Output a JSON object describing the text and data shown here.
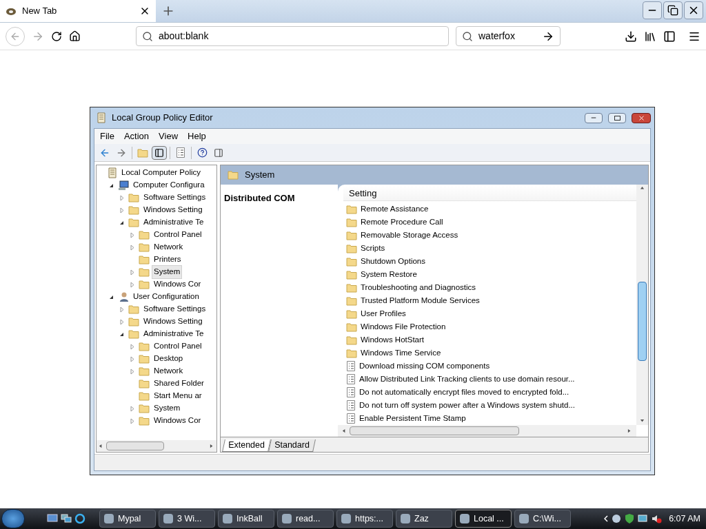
{
  "browser": {
    "tab": {
      "title": "New Tab",
      "selected": true
    },
    "address": "about:blank",
    "search": "waterfox"
  },
  "window": {
    "title": "Local Group Policy Editor",
    "menu": [
      "File",
      "Action",
      "View",
      "Help"
    ],
    "tree": [
      {
        "label": "Local Computer Policy",
        "kind": "policy",
        "selected": false,
        "children": [
          {
            "label": "Computer Configura",
            "kind": "computer",
            "expanded": true,
            "selected": false,
            "children": [
              {
                "label": "Software Settings",
                "kind": "folder",
                "expanded": false,
                "selected": false
              },
              {
                "label": "Windows Setting",
                "kind": "folder",
                "expanded": false,
                "selected": false
              },
              {
                "label": "Administrative Te",
                "kind": "folder",
                "expanded": true,
                "selected": false,
                "children": [
                  {
                    "label": "Control Panel",
                    "kind": "folder",
                    "expanded": false,
                    "selected": false
                  },
                  {
                    "label": "Network",
                    "kind": "folder",
                    "expanded": false,
                    "selected": false
                  },
                  {
                    "label": "Printers",
                    "kind": "folder",
                    "selected": false
                  },
                  {
                    "label": "System",
                    "kind": "folder",
                    "expanded": false,
                    "selected": true
                  },
                  {
                    "label": "Windows Cor",
                    "kind": "folder",
                    "expanded": false,
                    "selected": false
                  }
                ]
              }
            ]
          },
          {
            "label": "User Configuration",
            "kind": "user",
            "expanded": true,
            "selected": false,
            "children": [
              {
                "label": "Software Settings",
                "kind": "folder",
                "expanded": false,
                "selected": false
              },
              {
                "label": "Windows Setting",
                "kind": "folder",
                "expanded": false,
                "selected": false
              },
              {
                "label": "Administrative Te",
                "kind": "folder",
                "expanded": true,
                "selected": false,
                "children": [
                  {
                    "label": "Control Panel",
                    "kind": "folder",
                    "expanded": false,
                    "selected": false
                  },
                  {
                    "label": "Desktop",
                    "kind": "folder",
                    "expanded": false,
                    "selected": false
                  },
                  {
                    "label": "Network",
                    "kind": "folder",
                    "expanded": false,
                    "selected": false
                  },
                  {
                    "label": "Shared Folder",
                    "kind": "folder",
                    "selected": false
                  },
                  {
                    "label": "Start Menu ar",
                    "kind": "folder",
                    "selected": false
                  },
                  {
                    "label": "System",
                    "kind": "folder",
                    "expanded": false,
                    "selected": false
                  },
                  {
                    "label": "Windows Cor",
                    "kind": "folder",
                    "expanded": false,
                    "selected": false
                  }
                ]
              }
            ]
          }
        ]
      }
    ],
    "header": "System",
    "description_title": "Distributed COM",
    "column": "Setting",
    "settings": [
      {
        "label": "Remote Assistance",
        "kind": "folder"
      },
      {
        "label": "Remote Procedure Call",
        "kind": "folder"
      },
      {
        "label": "Removable Storage Access",
        "kind": "folder"
      },
      {
        "label": "Scripts",
        "kind": "folder"
      },
      {
        "label": "Shutdown Options",
        "kind": "folder"
      },
      {
        "label": "System Restore",
        "kind": "folder"
      },
      {
        "label": "Troubleshooting and Diagnostics",
        "kind": "folder"
      },
      {
        "label": "Trusted Platform Module Services",
        "kind": "folder"
      },
      {
        "label": "User Profiles",
        "kind": "folder"
      },
      {
        "label": "Windows File Protection",
        "kind": "folder"
      },
      {
        "label": "Windows HotStart",
        "kind": "folder"
      },
      {
        "label": "Windows Time Service",
        "kind": "folder"
      },
      {
        "label": "Download missing COM components",
        "kind": "setting"
      },
      {
        "label": "Allow Distributed Link Tracking clients to use domain resour...",
        "kind": "setting"
      },
      {
        "label": "Do not automatically encrypt files moved to encrypted fold...",
        "kind": "setting"
      },
      {
        "label": "Do not turn off system power after a Windows system shutd...",
        "kind": "setting"
      },
      {
        "label": "Enable Persistent Time Stamp",
        "kind": "setting"
      }
    ],
    "view_tabs": [
      {
        "label": "Extended",
        "selected": true
      },
      {
        "label": "Standard",
        "selected": false
      }
    ]
  },
  "taskbar": {
    "items": [
      {
        "label": "Mypal",
        "selected": false
      },
      {
        "label": "3 Wi...",
        "selected": false
      },
      {
        "label": "InkBall",
        "selected": false
      },
      {
        "label": "read...",
        "selected": false
      },
      {
        "label": "https:...",
        "selected": false
      },
      {
        "label": "Zaz",
        "selected": false
      },
      {
        "label": "Local ...",
        "selected": true
      },
      {
        "label": "C:\\Wi...",
        "selected": false
      }
    ],
    "clock": "6:07 AM"
  }
}
